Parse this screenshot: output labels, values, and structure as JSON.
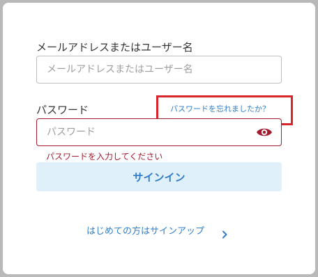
{
  "login": {
    "email_label": "メールアドレスまたはユーザー名",
    "email_placeholder": "メールアドレスまたはユーザー名",
    "email_value": "",
    "password_label": "パスワード",
    "forgot_link": "パスワードを忘れましたか？",
    "password_placeholder": "パスワード",
    "password_value": "",
    "password_error": "パスワードを入力してください",
    "signin_button": "サインイン",
    "signup_link": "はじめての方はサインアップ"
  },
  "icons": {
    "password_toggle": "eye-icon",
    "signup_chevron": "chevron-right-icon"
  },
  "colors": {
    "link": "#2f7ec7",
    "error": "#a31b2e",
    "button_bg": "#dff0fb",
    "highlight": "#d7262b"
  }
}
